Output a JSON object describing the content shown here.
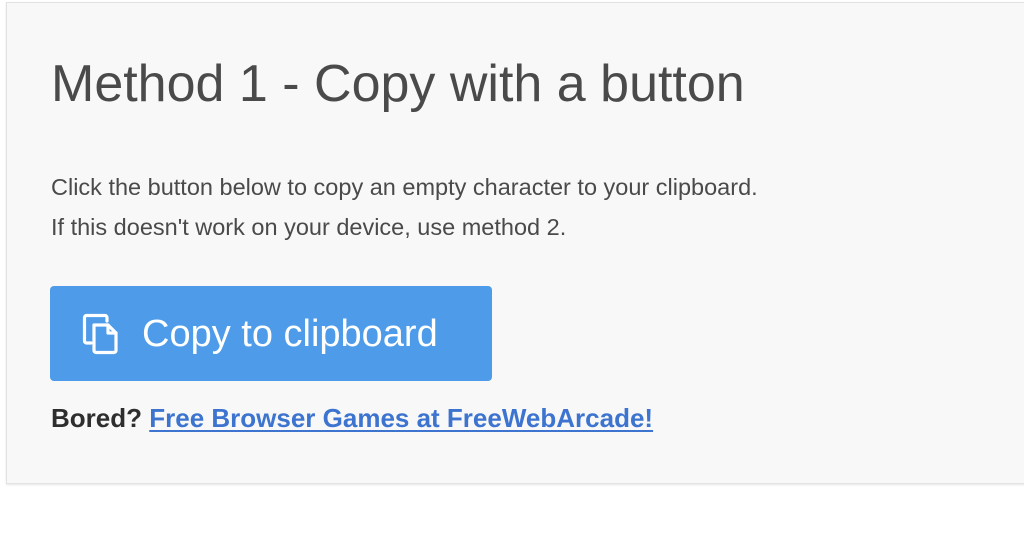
{
  "section": {
    "title": "Method 1 - Copy with a button",
    "description_lines": [
      "Click the button below to copy an empty character to your clipboard.",
      "If this doesn't work on your device, use method 2."
    ]
  },
  "copy_button": {
    "icon": "copy-icon",
    "label": "Copy to clipboard",
    "color": "#4d9be9"
  },
  "promo": {
    "prefix": "Bored?",
    "link_text": "Free Browser Games at FreeWebArcade!",
    "link_color": "#3c74cf"
  }
}
